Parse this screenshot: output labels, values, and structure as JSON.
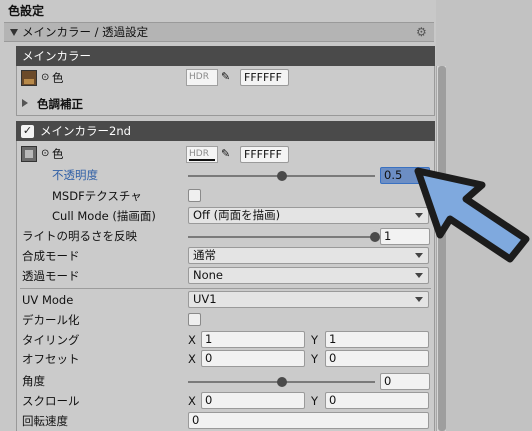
{
  "section_title": "色設定",
  "group": {
    "label": "メインカラー / 透過設定"
  },
  "main_color_box": {
    "title": "メインカラー",
    "color_label": "色",
    "hdr_label": "HDR",
    "hex_value": "FFFFFF",
    "color_correction_label": "色調補正"
  },
  "main_color_2nd": {
    "title": "メインカラー2nd",
    "enabled": true,
    "color_label": "色",
    "hdr_label": "HDR",
    "hex_value": "FFFFFF",
    "opacity_label": "不透明度",
    "opacity_value": "0.5",
    "opacity_level": 0.5,
    "msdf_label": "MSDFテクスチャ",
    "msdf_checked": false,
    "cull_mode_label": "Cull Mode (描画面)",
    "cull_mode_value": "Off (両面を描画)",
    "light_label": "ライトの明るさを反映",
    "light_value": "1",
    "light_level": 1,
    "blend_label": "合成モード",
    "blend_value": "通常",
    "alpha_mode_label": "透過モード",
    "alpha_mode_value": "None",
    "uv_mode_label": "UV Mode",
    "uv_mode_value": "UV1",
    "decal_label": "デカール化",
    "decal_checked": false,
    "tiling_label": "タイリング",
    "tiling_x_label": "X",
    "tiling_x": "1",
    "tiling_y_label": "Y",
    "tiling_y": "1",
    "offset_label": "オフセット",
    "offset_x_label": "X",
    "offset_x": "0",
    "offset_y_label": "Y",
    "offset_y": "0",
    "angle_label": "角度",
    "angle_value": "0",
    "angle_level": 0.5,
    "scroll_label": "スクロール",
    "scroll_x_label": "X",
    "scroll_x": "0",
    "scroll_y_label": "Y",
    "scroll_y": "0",
    "rotation_speed_label": "回転速度",
    "rotation_speed_value": "0"
  },
  "colors": {
    "accent_highlight": "#3a71c1",
    "annotation_arrow_fill": "#7fa9de",
    "annotation_arrow_stroke": "#1c1c1c",
    "header_dark": "#4a4a4a"
  }
}
